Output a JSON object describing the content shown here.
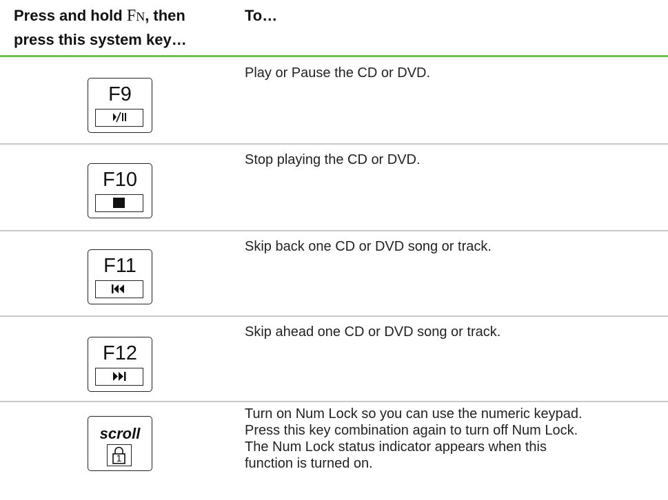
{
  "header": {
    "key_col_line1_prefix": "Press and hold ",
    "key_col_fn_f": "F",
    "key_col_fn_n": "N",
    "key_col_line1_suffix": ", then",
    "key_col_line2": "press this system key…",
    "action_col": "To…"
  },
  "rows": [
    {
      "key_label": "F9",
      "icon": "play-pause-icon",
      "description": "Play or Pause the CD or DVD."
    },
    {
      "key_label": "F10",
      "icon": "stop-icon",
      "description": "Stop playing the CD or DVD."
    },
    {
      "key_label": "F11",
      "icon": "skip-back-icon",
      "description": "Skip back one CD or DVD song or track."
    },
    {
      "key_label": "F12",
      "icon": "skip-forward-icon",
      "description": "Skip ahead one CD or DVD song or track."
    },
    {
      "key_label": "scroll",
      "icon": "num-lock-icon",
      "icon_digit": "1",
      "description_lines": [
        "Turn on Num Lock so you can use the numeric keypad.",
        "Press this key combination again to turn off Num Lock.",
        "The Num Lock status indicator appears when this",
        "function is turned on."
      ]
    }
  ],
  "colors": {
    "header_rule": "#6cbf4a",
    "row_separator": "#c7c7c7",
    "text": "#222222"
  }
}
